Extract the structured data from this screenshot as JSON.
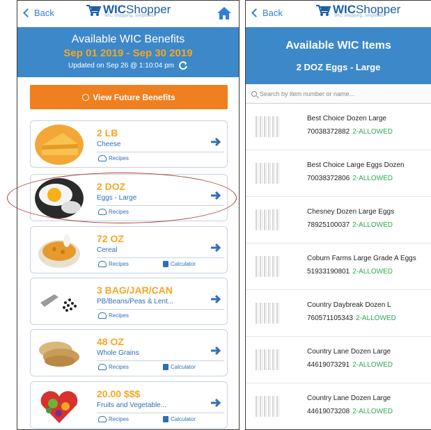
{
  "left": {
    "back_label": "Back",
    "logo": {
      "brand_bold": "WIC",
      "brand_rest": "Shopper",
      "tagline": "WIC shopping, simplified."
    },
    "banner": {
      "title": "Available WIC Benefits",
      "period": "Sep 01 2019 - Sep 30 2019",
      "updated": "Updated on Sep 26 @ 1:10:04 pm"
    },
    "future_button": "View Future Benefits",
    "recipes_label": "Recipes",
    "calculator_label": "Calculator",
    "benefits": [
      {
        "qty": "2 LB",
        "name": "Cheese",
        "image_icon": "cheese-image"
      },
      {
        "qty": "2 DOZ",
        "name": "Eggs - Large",
        "image_icon": "egg-image"
      },
      {
        "qty": "72 OZ",
        "name": "Cereal",
        "image_icon": "cereal-image"
      },
      {
        "qty": "3 BAG/JAR/CAN",
        "name": "PB/Beans/Peas & Lent...",
        "image_icon": "beans-image"
      },
      {
        "qty": "48 OZ",
        "name": "Whole Grains",
        "image_icon": "grains-image"
      },
      {
        "qty": "20.00 $$$",
        "name": "Fruits and Vegetable...",
        "image_icon": "produce-image"
      }
    ]
  },
  "right": {
    "back_label": "Back",
    "logo": {
      "brand_bold": "WIC",
      "brand_rest": "Shopper",
      "tagline": "WIC shopping, simplified."
    },
    "banner": {
      "title": "Available WIC Items",
      "subtitle": "2 DOZ Eggs - Large"
    },
    "search_placeholder": "Search by item number or name...",
    "items": [
      {
        "name": "Best Choice Dozen Large",
        "code": "70038372882",
        "status": "2-ALLOWED"
      },
      {
        "name": "Best Choice Large Eggs Dozen",
        "code": "70038372806",
        "status": "2-ALLOWED"
      },
      {
        "name": "Chesney Dozen Large Eggs",
        "code": "78925100037",
        "status": "2-ALLOWED"
      },
      {
        "name": "Coburn Farms Large Grade A Eggs",
        "code": "51933190801",
        "status": "2-ALLOWED"
      },
      {
        "name": "Country Daybreak Dozen L",
        "code": "760571105343",
        "status": "2-ALLOWED"
      },
      {
        "name": "Country Lane Dozen Large",
        "code": "44619073291",
        "status": "2-ALLOWED"
      },
      {
        "name": "Country Lane Dozen Large",
        "code": "44619073208",
        "status": "2-ALLOWED"
      }
    ]
  },
  "colors": {
    "accent": "#3d88c9",
    "orange": "#f07f1f",
    "amount": "#f5a623",
    "allowed": "#2fa84f",
    "highlight": "#b03a3a"
  }
}
